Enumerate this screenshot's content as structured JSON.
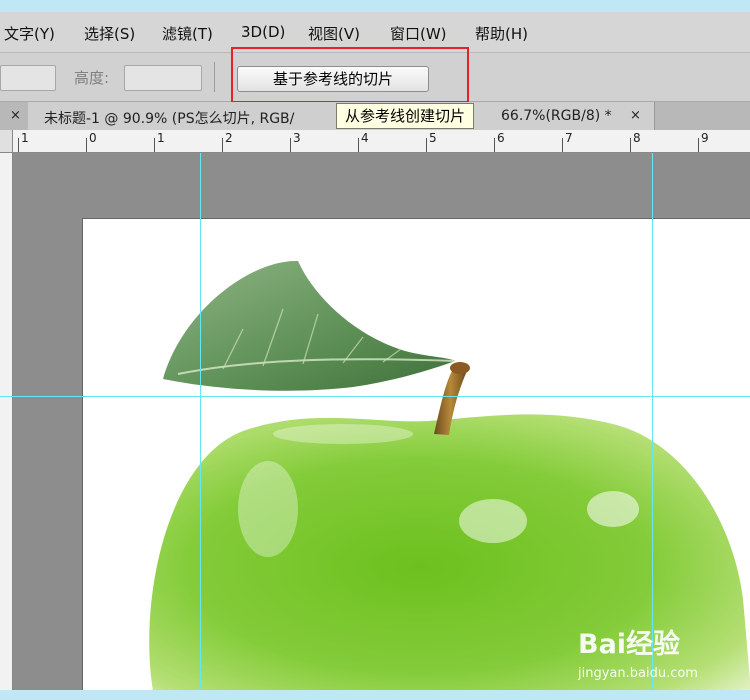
{
  "menubar": {
    "items": [
      "文字(Y)",
      "选择(S)",
      "滤镜(T)",
      "3D(D)",
      "视图(V)",
      "窗口(W)",
      "帮助(H)"
    ]
  },
  "options": {
    "height_label": "高度:",
    "slice_button": "基于参考线的切片",
    "tooltip": "从参考线创建切片"
  },
  "tabs": {
    "close_glyph": "×",
    "active_title": "未标题-1 @ 90.9% (PS怎么切片, RGB/",
    "next_title": "66.7%(RGB/8) *"
  },
  "ruler": {
    "labels": [
      "1",
      "0",
      "1",
      "2",
      "3",
      "4",
      "5",
      "6",
      "7",
      "8",
      "9"
    ]
  },
  "watermark": {
    "brand": "Bai经验",
    "url": "jingyan.baidu.com"
  },
  "colors": {
    "guide": "#66e6ee",
    "highlight": "#e8202a",
    "apple": "#7cc832"
  }
}
